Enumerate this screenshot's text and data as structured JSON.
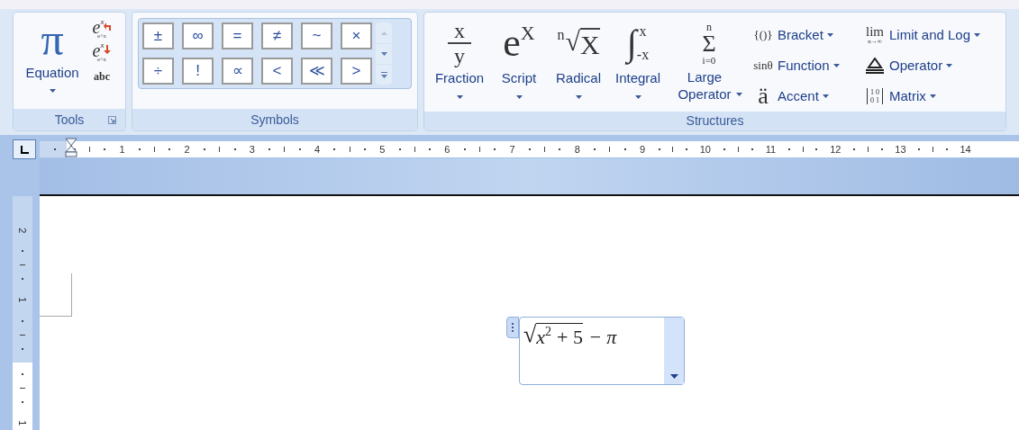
{
  "tools": {
    "label": "Tools",
    "equation": "Equation",
    "equation_glyph": "π",
    "professional": {
      "glyph": "e",
      "sup": "x",
      "caption": "e^x"
    },
    "linear": {
      "glyph": "e",
      "sup": "x",
      "caption": "e^x"
    },
    "normal_text": "abc"
  },
  "symbols": {
    "label": "Symbols",
    "items": [
      "±",
      "∞",
      "=",
      "≠",
      "~",
      "×",
      "÷",
      "!",
      "∝",
      "<",
      "≪",
      ">"
    ]
  },
  "structures": {
    "label": "Structures",
    "large": [
      {
        "kind": "fraction",
        "label": "Fraction",
        "top": "x",
        "bottom": "y"
      },
      {
        "kind": "script",
        "label": "Script",
        "base": "e",
        "sup": "X"
      },
      {
        "kind": "radical",
        "label": "Radical",
        "index": "n",
        "sign": "√",
        "base": "X"
      },
      {
        "kind": "integral",
        "label": "Integral",
        "sign": "∫",
        "upper": "x",
        "lower": "-x"
      },
      {
        "kind": "large_operator",
        "label": "Large Operator",
        "sign": "Σ",
        "upper": "n",
        "lower": "i=0"
      }
    ],
    "small": [
      {
        "kind": "text",
        "label": "Bracket",
        "glyph": "{()}"
      },
      {
        "kind": "text",
        "label": "Function",
        "glyph": "sinθ"
      },
      {
        "kind": "accent",
        "label": "Accent",
        "glyph": "ä"
      },
      {
        "kind": "limit",
        "label": "Limit and Log",
        "glyph": "lim",
        "sub": "n→∞"
      },
      {
        "kind": "icon",
        "label": "Operator"
      },
      {
        "kind": "matrix",
        "label": "Matrix",
        "cells": [
          "1",
          "0",
          "0",
          "1"
        ]
      }
    ]
  },
  "ruler": {
    "numbers": [
      "1",
      "2",
      "3",
      "4",
      "5",
      "6",
      "7",
      "8",
      "9",
      "10",
      "11",
      "12",
      "13",
      "14"
    ],
    "vertical_numbers": [
      "2",
      "1",
      "1"
    ]
  },
  "equation": {
    "sign": "√",
    "base": "x",
    "exponent": "2",
    "radicand_rest": "+ 5",
    "rest": "− π"
  }
}
